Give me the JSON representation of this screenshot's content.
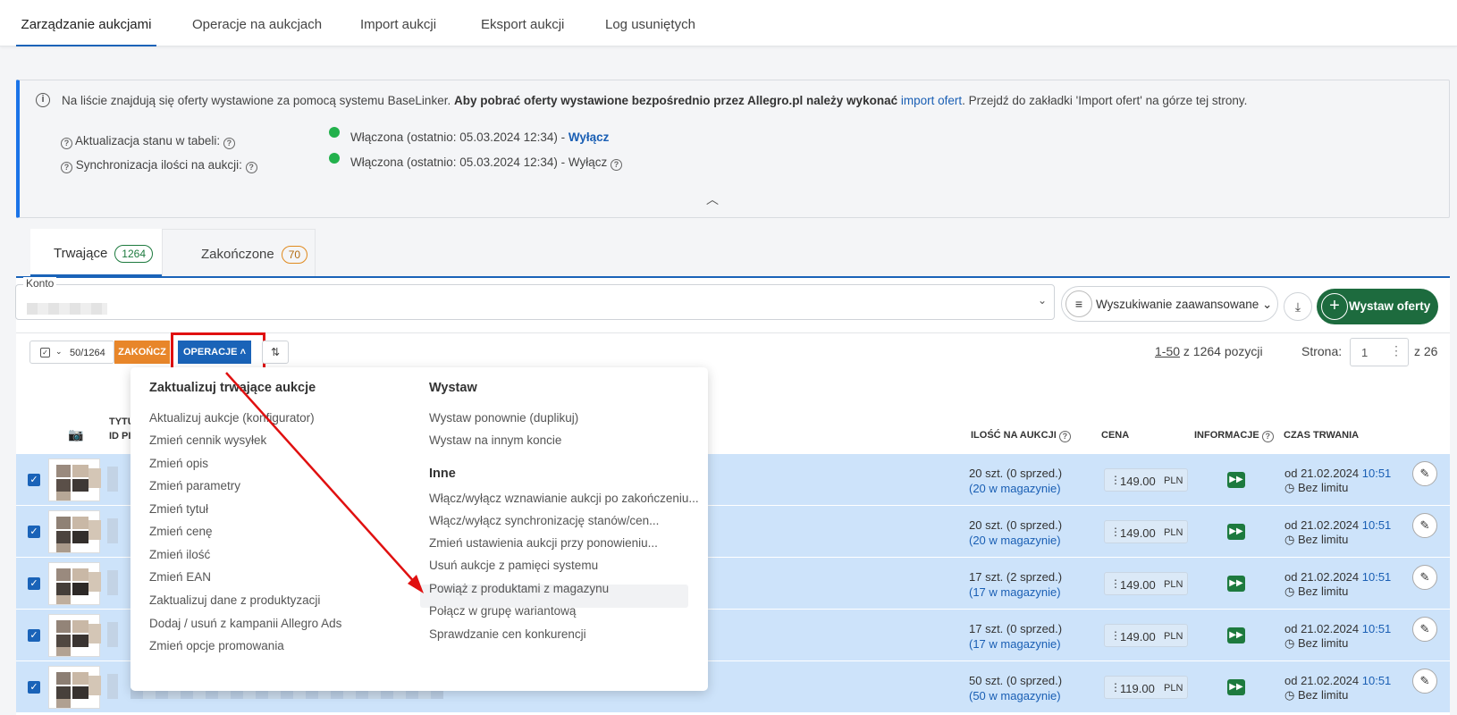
{
  "top_tabs": [
    "Zarządzanie aukcjami",
    "Operacje na aukcjach",
    "Import aukcji",
    "Eksport aukcji",
    "Log usuniętych"
  ],
  "notice": {
    "text_plain": "Na liście znajdują się oferty wystawione za pomocą systemu BaseLinker. ",
    "text_bold": "Aby pobrać oferty wystawione bezpośrednio przez Allegro.pl należy wykonać ",
    "link": "import ofert",
    "text_after": ". Przejdź do zakładki 'Import ofert' na górze tej strony.",
    "row1_label": "Aktualizacja stanu w tabeli:",
    "row1_status": "Włączona (ostatnio: 05.03.2024 12:34) - ",
    "row1_action": "Wyłącz",
    "row2_label": "Synchronizacja ilości na aukcji:",
    "row2_status": "Włączona (ostatnio: 05.03.2024 12:34) - Wyłącz"
  },
  "subtabs": [
    {
      "label": "Trwające",
      "count": "1264"
    },
    {
      "label": "Zakończone",
      "count": "70"
    }
  ],
  "filter": {
    "konto_label": "Konto",
    "advanced_label": "Wyszukiwanie zaawansowane",
    "add_button": "Wystaw oferty"
  },
  "toolbar": {
    "selected": "50/1264",
    "finish": "ZAKOŃCZ",
    "operations": "OPERACJE"
  },
  "pagination": {
    "range": "1-50",
    "of_total": "z 1264 pozycji",
    "page_label": "Strona:",
    "page_value": "1",
    "page_total": "z 26"
  },
  "columns": {
    "title_partial": "TYTU",
    "id_partial": "ID PI",
    "qty": "ILOŚĆ NA AUKCJI",
    "price": "CENA",
    "info": "INFORMACJE",
    "duration": "CZAS TRWANIA"
  },
  "rows": [
    {
      "qty": "20 szt. (0 sprzed.)",
      "stock": "(20 w magazynie)",
      "price": "149.00",
      "currency": "PLN",
      "date": "od 21.02.2024 ",
      "time": "10:51",
      "limit": "Bez limitu"
    },
    {
      "qty": "20 szt. (0 sprzed.)",
      "stock": "(20 w magazynie)",
      "price": "149.00",
      "currency": "PLN",
      "date": "od 21.02.2024 ",
      "time": "10:51",
      "limit": "Bez limitu"
    },
    {
      "qty": "17 szt. (2 sprzed.)",
      "stock": "(17 w magazynie)",
      "price": "149.00",
      "currency": "PLN",
      "date": "od 21.02.2024 ",
      "time": "10:51",
      "limit": "Bez limitu"
    },
    {
      "qty": "17 szt. (0 sprzed.)",
      "stock": "(17 w magazynie)",
      "price": "149.00",
      "currency": "PLN",
      "date": "od 21.02.2024 ",
      "time": "10:51",
      "limit": "Bez limitu"
    },
    {
      "qty": "50 szt. (0 sprzed.)",
      "stock": "(50 w magazynie)",
      "price": "119.00",
      "currency": "PLN",
      "date": "od 21.02.2024 ",
      "time": "10:51",
      "limit": "Bez limitu"
    }
  ],
  "menu": {
    "update_heading": "Zaktualizuj trwające aukcje",
    "update_items": [
      "Aktualizuj aukcje (konfigurator)",
      "Zmień cennik wysyłek",
      "Zmień opis",
      "Zmień parametry",
      "Zmień tytuł",
      "Zmień cenę",
      "Zmień ilość",
      "Zmień EAN",
      "Zaktualizuj dane z produktyzacji",
      "Dodaj / usuń z kampanii Allegro Ads",
      "Zmień opcje promowania"
    ],
    "list_heading": "Wystaw",
    "list_items": [
      "Wystaw ponownie (duplikuj)",
      "Wystaw na innym koncie"
    ],
    "other_heading": "Inne",
    "other_items": [
      "Włącz/wyłącz wznawianie aukcji po zakończeniu...",
      "Włącz/wyłącz synchronizację stanów/cen...",
      "Zmień ustawienia aukcji przy ponowieniu...",
      "Usuń aukcje z pamięci systemu",
      "Powiąż z produktami z magazynu",
      "Połącz w grupę wariantową",
      "Sprawdzanie cen konkurencji"
    ]
  },
  "colors": {
    "accent": "#1a63b8",
    "success": "#1d6b3e",
    "warning": "#e8862a",
    "highlight_box": "#e01010",
    "row_selected": "#cde3fa"
  },
  "icons": [
    "info-icon",
    "help-icon",
    "chevron-up-icon",
    "chevron-down-icon",
    "filter-icon",
    "download-icon",
    "plus-icon",
    "checkbox-icon",
    "sort-icon",
    "camera-icon",
    "fast-forward-icon",
    "clock-icon",
    "pencil-icon",
    "kebab-icon"
  ]
}
